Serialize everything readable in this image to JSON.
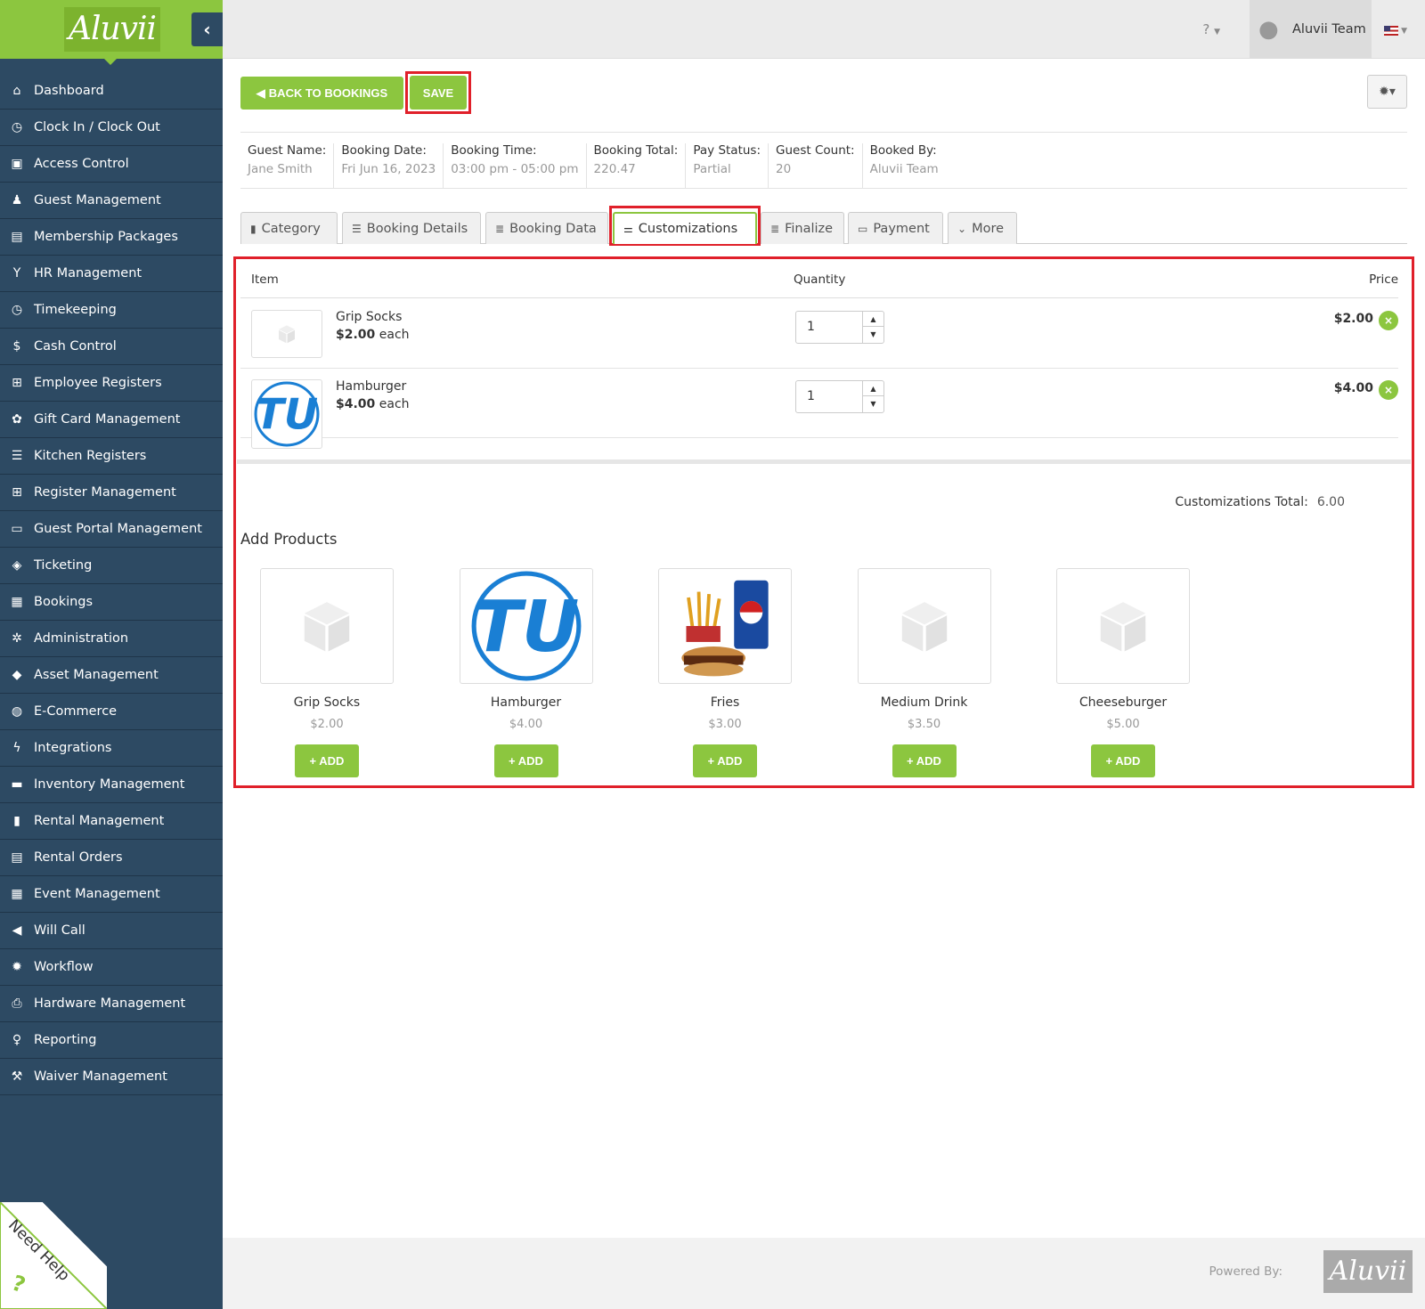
{
  "app": {
    "logo": "Aluvii"
  },
  "sidebar": {
    "items": [
      {
        "label": "Dashboard",
        "icon": "home-icon",
        "glyph": "⌂"
      },
      {
        "label": "Clock In / Clock Out",
        "icon": "clock-icon",
        "glyph": "◷"
      },
      {
        "label": "Access Control",
        "icon": "lock-icon",
        "glyph": "▣"
      },
      {
        "label": "Guest Management",
        "icon": "users-icon",
        "glyph": "♟"
      },
      {
        "label": "Membership Packages",
        "icon": "card-icon",
        "glyph": "▤"
      },
      {
        "label": "HR Management",
        "icon": "glass-icon",
        "glyph": "Y"
      },
      {
        "label": "Timekeeping",
        "icon": "clock-icon",
        "glyph": "◷"
      },
      {
        "label": "Cash Control",
        "icon": "dollar-icon",
        "glyph": "$"
      },
      {
        "label": "Employee Registers",
        "icon": "cart-icon",
        "glyph": "⊞"
      },
      {
        "label": "Gift Card Management",
        "icon": "gift-icon",
        "glyph": "✿"
      },
      {
        "label": "Kitchen Registers",
        "icon": "list-icon",
        "glyph": "☰"
      },
      {
        "label": "Register Management",
        "icon": "cart-plus-icon",
        "glyph": "⊞"
      },
      {
        "label": "Guest Portal Management",
        "icon": "laptop-icon",
        "glyph": "▭"
      },
      {
        "label": "Ticketing",
        "icon": "ticket-icon",
        "glyph": "◈"
      },
      {
        "label": "Bookings",
        "icon": "calendar-plus-icon",
        "glyph": "▦"
      },
      {
        "label": "Administration",
        "icon": "cogs-icon",
        "glyph": "✲"
      },
      {
        "label": "Asset Management",
        "icon": "cubes-icon",
        "glyph": "◆"
      },
      {
        "label": "E-Commerce",
        "icon": "globe-icon",
        "glyph": "◍"
      },
      {
        "label": "Integrations",
        "icon": "bolt-icon",
        "glyph": "ϟ"
      },
      {
        "label": "Inventory Management",
        "icon": "archive-icon",
        "glyph": "▬"
      },
      {
        "label": "Rental Management",
        "icon": "clipboard-icon",
        "glyph": "▮"
      },
      {
        "label": "Rental Orders",
        "icon": "list-alt-icon",
        "glyph": "▤"
      },
      {
        "label": "Event Management",
        "icon": "calendar-check-icon",
        "glyph": "▦"
      },
      {
        "label": "Will Call",
        "icon": "bullhorn-icon",
        "glyph": "◀"
      },
      {
        "label": "Workflow",
        "icon": "cog-icon",
        "glyph": "✹"
      },
      {
        "label": "Hardware Management",
        "icon": "print-icon",
        "glyph": "⎙"
      },
      {
        "label": "Reporting",
        "icon": "lightbulb-icon",
        "glyph": "♀"
      },
      {
        "label": "Waiver Management",
        "icon": "gavel-icon",
        "glyph": "⚒"
      }
    ]
  },
  "topbar": {
    "help_icon": "question-icon",
    "user_name": "Aluvii Team",
    "language": "flag-us-icon"
  },
  "actions": {
    "back_label": "BACK TO BOOKINGS",
    "save_label": "SAVE",
    "settings_icon": "gear-icon"
  },
  "booking_info": [
    {
      "label": "Guest Name:",
      "value": "Jane Smith"
    },
    {
      "label": "Booking Date:",
      "value": "Fri Jun 16, 2023"
    },
    {
      "label": "Booking Time:",
      "value": "03:00 pm - 05:00 pm"
    },
    {
      "label": "Booking Total:",
      "value": "220.47"
    },
    {
      "label": "Pay Status:",
      "value": "Partial"
    },
    {
      "label": "Guest Count:",
      "value": "20"
    },
    {
      "label": "Booked By:",
      "value": "Aluvii Team"
    }
  ],
  "tabs": [
    {
      "label": "Category",
      "icon": "book-icon",
      "glyph": "▮"
    },
    {
      "label": "Booking Details",
      "icon": "list-icon",
      "glyph": "☰"
    },
    {
      "label": "Booking Data",
      "icon": "database-icon",
      "glyph": "≣"
    },
    {
      "label": "Customizations",
      "icon": "sliders-icon",
      "glyph": "⚌",
      "active": true
    },
    {
      "label": "Finalize",
      "icon": "database-icon",
      "glyph": "≣"
    },
    {
      "label": "Payment",
      "icon": "credit-card-icon",
      "glyph": "▭"
    },
    {
      "label": "More",
      "icon": "chevron-circle-down-icon",
      "glyph": "⌄"
    }
  ],
  "customizations": {
    "headers": {
      "item": "Item",
      "quantity": "Quantity",
      "price": "Price"
    },
    "rows": [
      {
        "name": "Grip Socks",
        "unit_price": "$2.00",
        "each": "each",
        "quantity": "1",
        "price": "$2.00",
        "image": "placeholder-box"
      },
      {
        "name": "Hamburger",
        "unit_price": "$4.00",
        "each": "each",
        "quantity": "1",
        "price": "$4.00",
        "image": "tu-logo"
      }
    ],
    "total_label": "Customizations Total:",
    "total_value": "6.00"
  },
  "add_products": {
    "title": "Add Products",
    "add_label": "ADD",
    "products": [
      {
        "name": "Grip Socks",
        "price": "$2.00",
        "image": "placeholder-box"
      },
      {
        "name": "Hamburger",
        "price": "$4.00",
        "image": "tu-logo"
      },
      {
        "name": "Fries",
        "price": "$3.00",
        "image": "fries-meal"
      },
      {
        "name": "Medium Drink",
        "price": "$3.50",
        "image": "placeholder-box"
      },
      {
        "name": "Cheeseburger",
        "price": "$5.00",
        "image": "placeholder-box"
      }
    ]
  },
  "footer": {
    "powered_by": "Powered By:",
    "logo": "Aluvii",
    "need_help": "Need Help"
  },
  "colors": {
    "brand_green": "#8cc63f",
    "sidebar_bg": "#2d4a63",
    "highlight_red": "#e0202a"
  }
}
